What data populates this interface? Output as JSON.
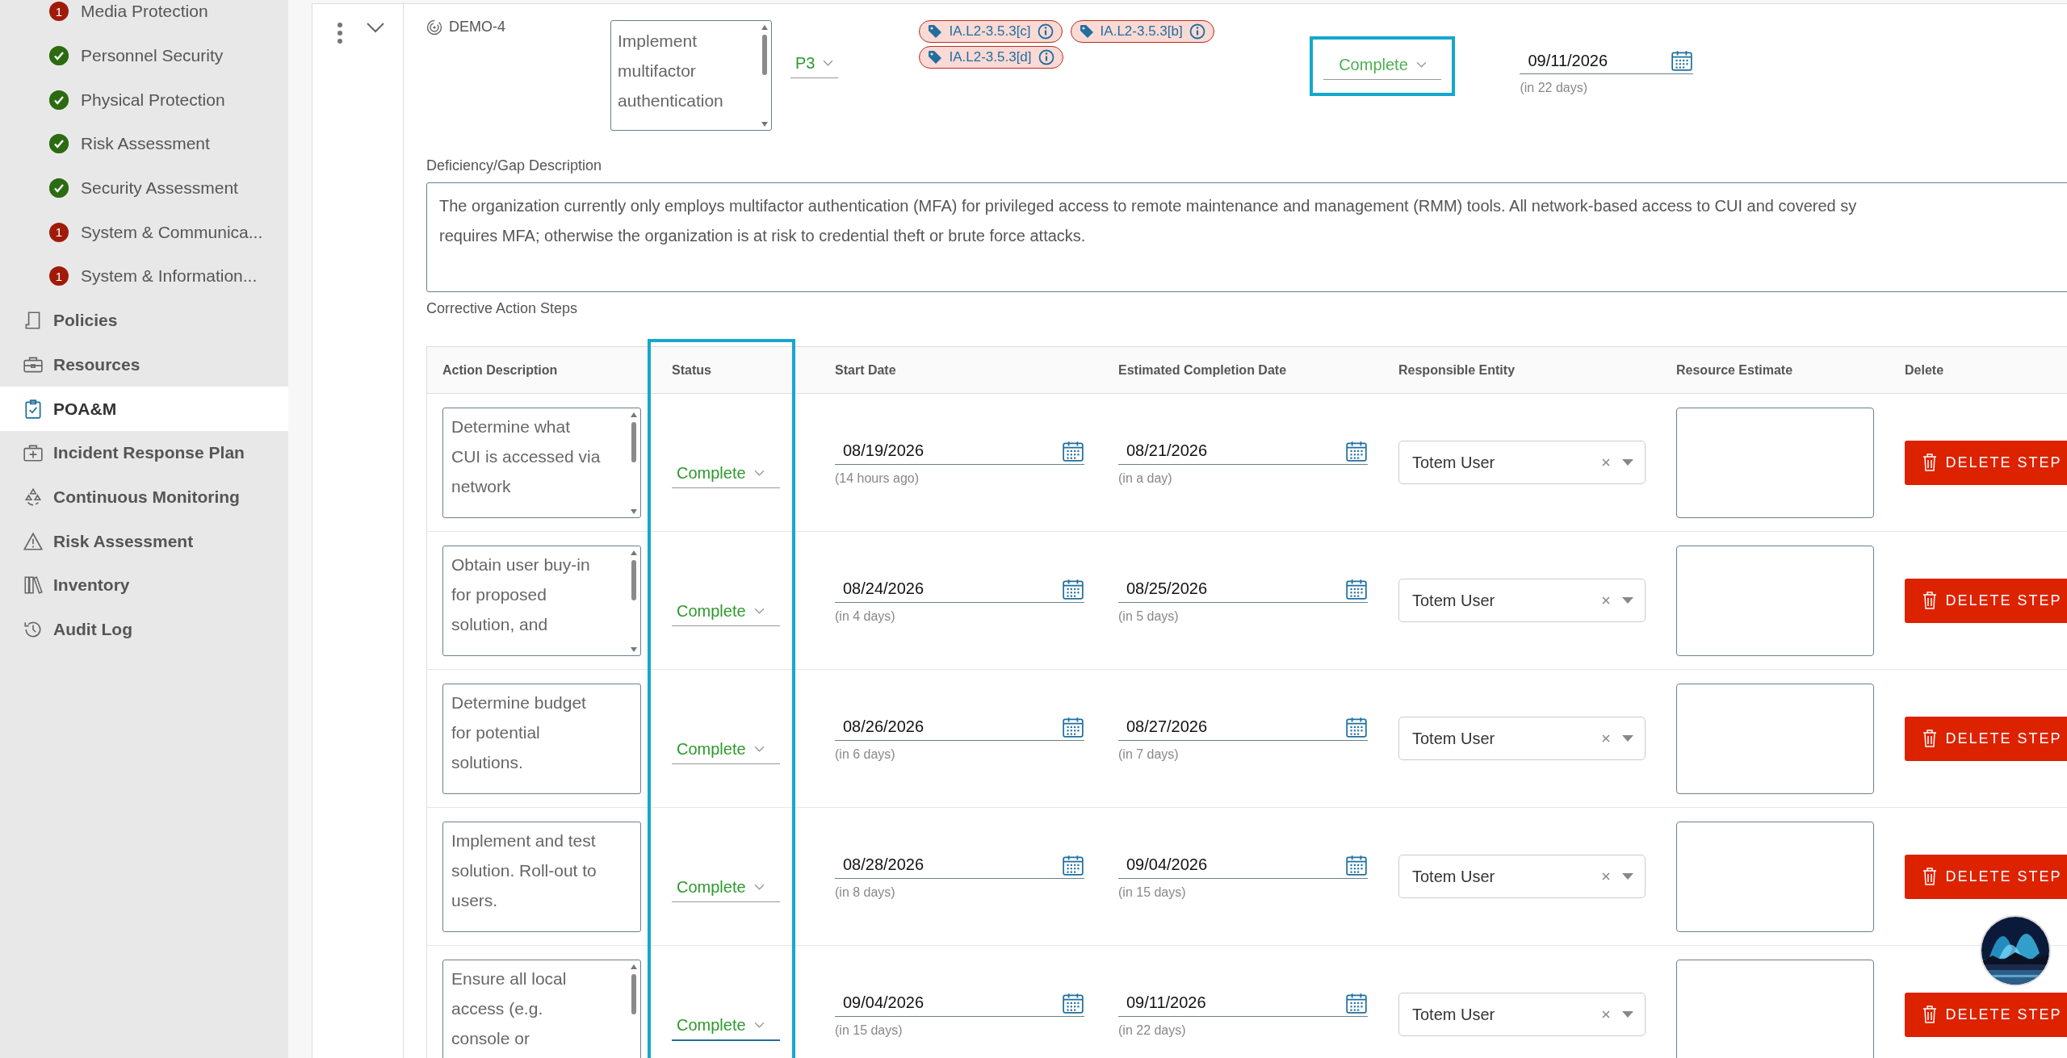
{
  "sidebar": {
    "sub_items": [
      {
        "label": "Media Protection",
        "kind": "issue",
        "count": "1"
      },
      {
        "label": "Personnel Security",
        "kind": "complete"
      },
      {
        "label": "Physical Protection",
        "kind": "complete"
      },
      {
        "label": "Risk Assessment",
        "kind": "complete"
      },
      {
        "label": "Security Assessment",
        "kind": "complete"
      },
      {
        "label": "System & Communica...",
        "kind": "issue",
        "count": "1"
      },
      {
        "label": "System & Information...",
        "kind": "issue",
        "count": "1"
      }
    ],
    "items": [
      {
        "label": "Policies",
        "selected": false
      },
      {
        "label": "Resources",
        "selected": false
      },
      {
        "label": "POA&M",
        "selected": true
      },
      {
        "label": "Incident Response Plan",
        "selected": false
      },
      {
        "label": "Continuous Monitoring",
        "selected": false
      },
      {
        "label": "Risk Assessment",
        "selected": false
      },
      {
        "label": "Inventory",
        "selected": false
      },
      {
        "label": "Audit Log",
        "selected": false
      }
    ]
  },
  "poam": {
    "id": "DEMO-4",
    "title": "Implement multifactor authentication",
    "title_overflowing": true,
    "priority": "P3",
    "tags": [
      {
        "label": "IA.L2-3.5.3[c]"
      },
      {
        "label": "IA.L2-3.5.3[b]"
      },
      {
        "label": "IA.L2-3.5.3[d]"
      }
    ],
    "status": "Complete",
    "date": {
      "value": "09/11/2026",
      "relative": "(in 22 days)"
    },
    "deficiency_label": "Deficiency/Gap Description",
    "deficiency_lines": [
      "The organization currently only employs multifactor authentication (MFA) for privileged access to remote maintenance and management (RMM) tools. All network-based access to CUI and covered sy",
      "requires MFA; otherwise the organization is at risk to credential theft or brute force attacks."
    ],
    "steps_label": "Corrective Action Steps"
  },
  "steps_table": {
    "columns": [
      "Action Description",
      "Status",
      "Start Date",
      "Estimated Completion Date",
      "Responsible Entity",
      "Resource Estimate",
      "Delete"
    ],
    "rows": [
      {
        "description": "Determine what CUI is accessed via network",
        "overflowing": true,
        "status": "Complete",
        "focused": false,
        "start": {
          "value": "08/19/2026",
          "relative": "(14 hours ago)"
        },
        "end": {
          "value": "08/21/2026",
          "relative": "(in a day)"
        },
        "responsible": "Totem User",
        "delete_label": "DELETE STEP"
      },
      {
        "description": "Obtain user buy-in for proposed solution, and",
        "overflowing": true,
        "status": "Complete",
        "focused": false,
        "start": {
          "value": "08/24/2026",
          "relative": "(in 4 days)"
        },
        "end": {
          "value": "08/25/2026",
          "relative": "(in 5 days)"
        },
        "responsible": "Totem User",
        "delete_label": "DELETE STEP"
      },
      {
        "description": "Determine budget for potential solutions.",
        "overflowing": false,
        "status": "Complete",
        "focused": false,
        "start": {
          "value": "08/26/2026",
          "relative": "(in 6 days)"
        },
        "end": {
          "value": "08/27/2026",
          "relative": "(in 7 days)"
        },
        "responsible": "Totem User",
        "delete_label": "DELETE STEP"
      },
      {
        "description": "Implement and test solution. Roll-out to users.",
        "overflowing": false,
        "status": "Complete",
        "focused": false,
        "start": {
          "value": "08/28/2026",
          "relative": "(in 8 days)"
        },
        "end": {
          "value": "09/04/2026",
          "relative": "(in 15 days)"
        },
        "responsible": "Totem User",
        "delete_label": "DELETE STEP"
      },
      {
        "description": "Ensure all local access (e.g. console or",
        "overflowing": true,
        "status": "Complete",
        "focused": true,
        "start": {
          "value": "09/04/2026",
          "relative": "(in 15 days)"
        },
        "end": {
          "value": "09/11/2026",
          "relative": "(in 22 days)"
        },
        "responsible": "Totem User",
        "delete_label": "DELETE STEP"
      }
    ]
  }
}
